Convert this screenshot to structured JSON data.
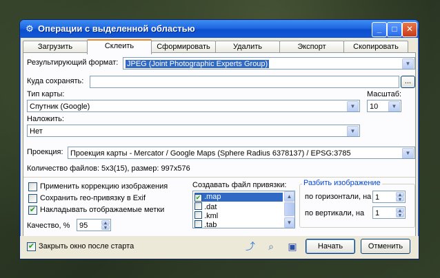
{
  "window": {
    "title": "Операции с выделенной областью",
    "minimize": "_",
    "maximize": "□",
    "close": "✕"
  },
  "tabs": [
    {
      "label": "Загрузить"
    },
    {
      "label": "Склеить"
    },
    {
      "label": "Сформировать"
    },
    {
      "label": "Удалить"
    },
    {
      "label": "Экспорт"
    },
    {
      "label": "Скопировать"
    }
  ],
  "active_tab": "Склеить",
  "form": {
    "result_format_label": "Результирующий формат:",
    "result_format_value": "JPEG (Joint Photographic Experts Group)",
    "save_to_label": "Куда сохранять:",
    "save_to_value": "",
    "browse_label": "...",
    "map_type_label": "Тип карты:",
    "map_type_value": "Спутник (Google)",
    "scale_label": "Масштаб:",
    "scale_value": "10",
    "overlay_label": "Наложить:",
    "overlay_value": "Нет",
    "projection_label": "Проекция:",
    "projection_value": "Проекция карты - Mercator / Google Maps (Sphere Radius 6378137) / EPSG:3785",
    "files_info": "Количество файлов: 5x3(15), размер: 997x576"
  },
  "options": {
    "color_correction": {
      "label": "Применить коррекцию изображения",
      "checked": false
    },
    "save_geo_exif": {
      "label": "Сохранить гео-привязку в Exif",
      "checked": false
    },
    "overlay_marks": {
      "label": "Накладывать отображаемые метки",
      "checked": true
    },
    "quality_label": "Качество, %",
    "quality_value": "95"
  },
  "binding": {
    "title": "Создавать файл привязки:",
    "items": [
      {
        "label": ".map",
        "checked": true,
        "selected": true
      },
      {
        "label": ".dat",
        "checked": false,
        "selected": false
      },
      {
        "label": ".kml",
        "checked": false,
        "selected": false
      },
      {
        "label": ".tab",
        "checked": false,
        "selected": false
      }
    ]
  },
  "split": {
    "title": "Разбить изображение",
    "horizontal_label": "по горизонтали, на",
    "horizontal_value": "1",
    "vertical_label": "по вертикали, на",
    "vertical_value": "1"
  },
  "footer": {
    "close_after_start": {
      "label": "Закрыть окно после старта",
      "checked": true
    },
    "start_label": "Начать",
    "cancel_label": "Отменить"
  },
  "icons": {
    "app": "gear-globe-icon",
    "path": "path-icon",
    "zoom": "zoom-icon",
    "save": "floppy-icon"
  }
}
